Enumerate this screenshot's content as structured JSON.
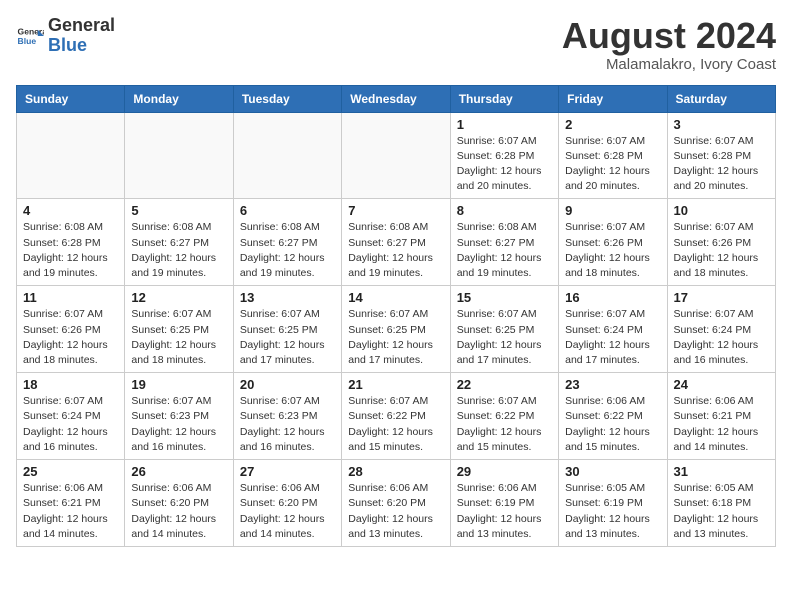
{
  "header": {
    "logo_general": "General",
    "logo_blue": "Blue",
    "month_year": "August 2024",
    "location": "Malamalakro, Ivory Coast"
  },
  "weekdays": [
    "Sunday",
    "Monday",
    "Tuesday",
    "Wednesday",
    "Thursday",
    "Friday",
    "Saturday"
  ],
  "weeks": [
    [
      {
        "day": "",
        "info": ""
      },
      {
        "day": "",
        "info": ""
      },
      {
        "day": "",
        "info": ""
      },
      {
        "day": "",
        "info": ""
      },
      {
        "day": "1",
        "info": "Sunrise: 6:07 AM\nSunset: 6:28 PM\nDaylight: 12 hours\nand 20 minutes."
      },
      {
        "day": "2",
        "info": "Sunrise: 6:07 AM\nSunset: 6:28 PM\nDaylight: 12 hours\nand 20 minutes."
      },
      {
        "day": "3",
        "info": "Sunrise: 6:07 AM\nSunset: 6:28 PM\nDaylight: 12 hours\nand 20 minutes."
      }
    ],
    [
      {
        "day": "4",
        "info": "Sunrise: 6:08 AM\nSunset: 6:28 PM\nDaylight: 12 hours\nand 19 minutes."
      },
      {
        "day": "5",
        "info": "Sunrise: 6:08 AM\nSunset: 6:27 PM\nDaylight: 12 hours\nand 19 minutes."
      },
      {
        "day": "6",
        "info": "Sunrise: 6:08 AM\nSunset: 6:27 PM\nDaylight: 12 hours\nand 19 minutes."
      },
      {
        "day": "7",
        "info": "Sunrise: 6:08 AM\nSunset: 6:27 PM\nDaylight: 12 hours\nand 19 minutes."
      },
      {
        "day": "8",
        "info": "Sunrise: 6:08 AM\nSunset: 6:27 PM\nDaylight: 12 hours\nand 19 minutes."
      },
      {
        "day": "9",
        "info": "Sunrise: 6:07 AM\nSunset: 6:26 PM\nDaylight: 12 hours\nand 18 minutes."
      },
      {
        "day": "10",
        "info": "Sunrise: 6:07 AM\nSunset: 6:26 PM\nDaylight: 12 hours\nand 18 minutes."
      }
    ],
    [
      {
        "day": "11",
        "info": "Sunrise: 6:07 AM\nSunset: 6:26 PM\nDaylight: 12 hours\nand 18 minutes."
      },
      {
        "day": "12",
        "info": "Sunrise: 6:07 AM\nSunset: 6:25 PM\nDaylight: 12 hours\nand 18 minutes."
      },
      {
        "day": "13",
        "info": "Sunrise: 6:07 AM\nSunset: 6:25 PM\nDaylight: 12 hours\nand 17 minutes."
      },
      {
        "day": "14",
        "info": "Sunrise: 6:07 AM\nSunset: 6:25 PM\nDaylight: 12 hours\nand 17 minutes."
      },
      {
        "day": "15",
        "info": "Sunrise: 6:07 AM\nSunset: 6:25 PM\nDaylight: 12 hours\nand 17 minutes."
      },
      {
        "day": "16",
        "info": "Sunrise: 6:07 AM\nSunset: 6:24 PM\nDaylight: 12 hours\nand 17 minutes."
      },
      {
        "day": "17",
        "info": "Sunrise: 6:07 AM\nSunset: 6:24 PM\nDaylight: 12 hours\nand 16 minutes."
      }
    ],
    [
      {
        "day": "18",
        "info": "Sunrise: 6:07 AM\nSunset: 6:24 PM\nDaylight: 12 hours\nand 16 minutes."
      },
      {
        "day": "19",
        "info": "Sunrise: 6:07 AM\nSunset: 6:23 PM\nDaylight: 12 hours\nand 16 minutes."
      },
      {
        "day": "20",
        "info": "Sunrise: 6:07 AM\nSunset: 6:23 PM\nDaylight: 12 hours\nand 16 minutes."
      },
      {
        "day": "21",
        "info": "Sunrise: 6:07 AM\nSunset: 6:22 PM\nDaylight: 12 hours\nand 15 minutes."
      },
      {
        "day": "22",
        "info": "Sunrise: 6:07 AM\nSunset: 6:22 PM\nDaylight: 12 hours\nand 15 minutes."
      },
      {
        "day": "23",
        "info": "Sunrise: 6:06 AM\nSunset: 6:22 PM\nDaylight: 12 hours\nand 15 minutes."
      },
      {
        "day": "24",
        "info": "Sunrise: 6:06 AM\nSunset: 6:21 PM\nDaylight: 12 hours\nand 14 minutes."
      }
    ],
    [
      {
        "day": "25",
        "info": "Sunrise: 6:06 AM\nSunset: 6:21 PM\nDaylight: 12 hours\nand 14 minutes."
      },
      {
        "day": "26",
        "info": "Sunrise: 6:06 AM\nSunset: 6:20 PM\nDaylight: 12 hours\nand 14 minutes."
      },
      {
        "day": "27",
        "info": "Sunrise: 6:06 AM\nSunset: 6:20 PM\nDaylight: 12 hours\nand 14 minutes."
      },
      {
        "day": "28",
        "info": "Sunrise: 6:06 AM\nSunset: 6:20 PM\nDaylight: 12 hours\nand 13 minutes."
      },
      {
        "day": "29",
        "info": "Sunrise: 6:06 AM\nSunset: 6:19 PM\nDaylight: 12 hours\nand 13 minutes."
      },
      {
        "day": "30",
        "info": "Sunrise: 6:05 AM\nSunset: 6:19 PM\nDaylight: 12 hours\nand 13 minutes."
      },
      {
        "day": "31",
        "info": "Sunrise: 6:05 AM\nSunset: 6:18 PM\nDaylight: 12 hours\nand 13 minutes."
      }
    ]
  ]
}
